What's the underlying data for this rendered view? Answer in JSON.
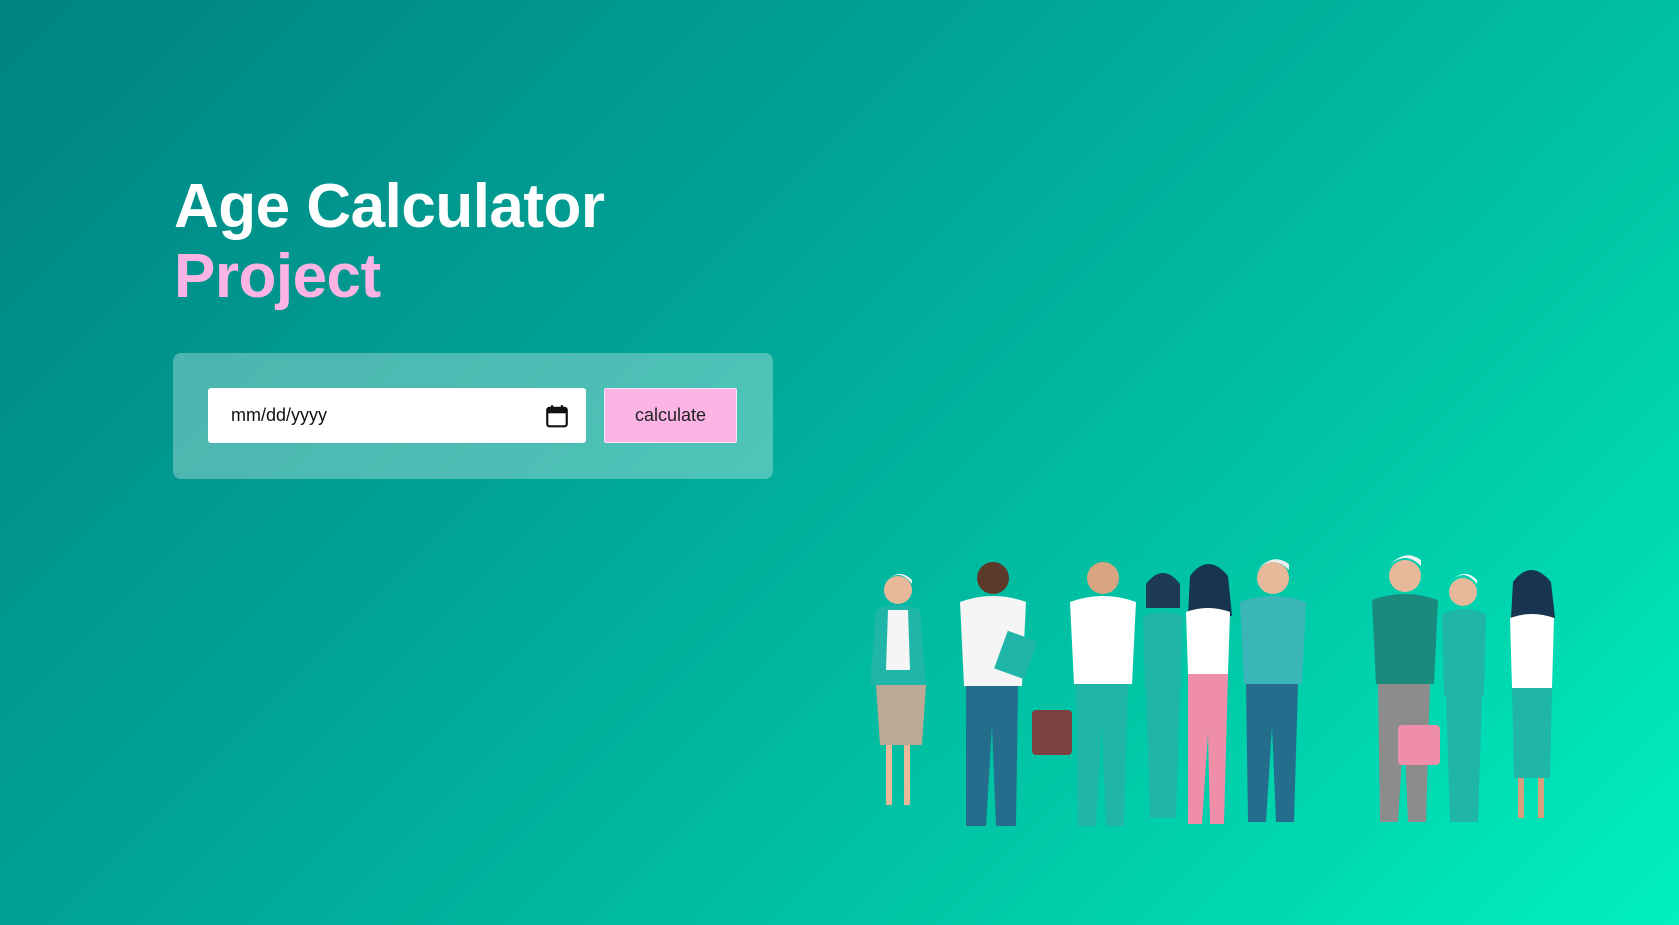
{
  "hero": {
    "title_line1": "Age Calculator",
    "title_line2": "Project"
  },
  "form": {
    "date_placeholder": "mm/dd/yyyy",
    "calendar_icon": "calendar-icon",
    "calculate_label": "calculate"
  },
  "illustration": {
    "icon": "group-of-people-illustration"
  },
  "colors": {
    "accent_pink": "#fbb4e4",
    "title_white": "#ffffff",
    "gradient_start": "#008383",
    "gradient_end": "#00f0c0"
  }
}
